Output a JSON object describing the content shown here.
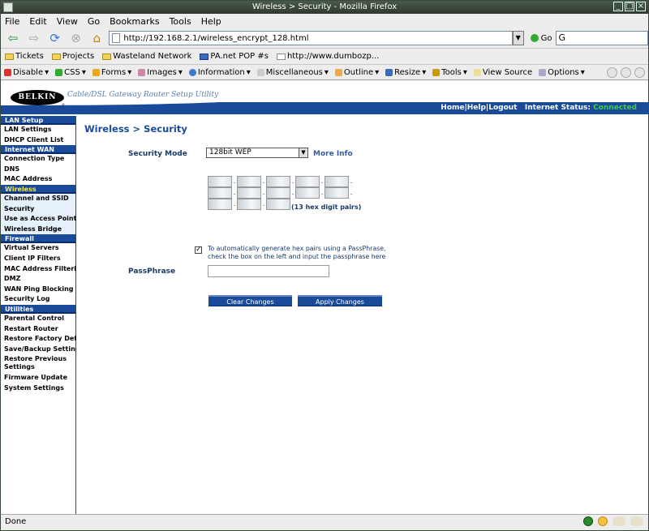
{
  "window": {
    "title": "Wireless > Security - Mozilla Firefox"
  },
  "menu": [
    "File",
    "Edit",
    "View",
    "Go",
    "Bookmarks",
    "Tools",
    "Help"
  ],
  "nav": {
    "url": "http://192.168.2.1/wireless_encrypt_128.html",
    "go_label": "Go",
    "search_value": "G"
  },
  "bookmarks": [
    "Tickets",
    "Projects",
    "Wasteland Network",
    "PA.net POP #s",
    "http://www.dumbozp..."
  ],
  "webdev": [
    "Disable",
    "CSS",
    "Forms",
    "Images",
    "Information",
    "Miscellaneous",
    "Outline",
    "Resize",
    "Tools",
    "View Source",
    "Options"
  ],
  "header": {
    "logo": "BELKIN",
    "tagline": "Cable/DSL Gateway Router Setup Utility",
    "links": "Home|Help|Logout",
    "internet_status_label": "Internet Status:",
    "internet_status_value": "Connected"
  },
  "sidebar": {
    "lan_setup": "LAN Setup",
    "lan_settings": "LAN Settings",
    "dhcp_client_list": "DHCP Client List",
    "internet_wan": "Internet WAN",
    "connection_type": "Connection Type",
    "dns": "DNS",
    "mac_address": "MAC Address",
    "wireless": "Wireless",
    "channel_ssid": "Channel and SSID",
    "security": "Security",
    "access_point": "Use as Access Point",
    "wireless_bridge": "Wireless Bridge",
    "firewall": "Firewall",
    "virtual_servers": "Virtual Servers",
    "client_ip_filters": "Client IP Filters",
    "mac_filtering": "MAC Address Filtering",
    "dmz": "DMZ",
    "wan_ping": "WAN Ping Blocking",
    "security_log": "Security Log",
    "utilities": "Utilities",
    "parental_control": "Parental Control",
    "restart_router": "Restart Router",
    "restore_factory": "Restore Factory Default",
    "save_backup": "Save/Backup Settings",
    "restore_previous": "Restore Previous Settings",
    "firmware_update": "Firmware Update",
    "system_settings": "System Settings"
  },
  "main": {
    "title": "Wireless > Security",
    "security_mode_label": "Security Mode",
    "security_mode_value": "128bit WEP",
    "more_info": "More Info",
    "key_hint": "(13 hex digit pairs)",
    "autogen_checked": true,
    "autogen_line1": "To automatically generate hex pairs using a PassPhrase,",
    "autogen_line2": "check the box on the left and input the passphrase here",
    "passphrase_label": "PassPhrase",
    "clear_button": "Clear Changes",
    "apply_button": "Apply Changes"
  },
  "status": {
    "text": "Done"
  }
}
